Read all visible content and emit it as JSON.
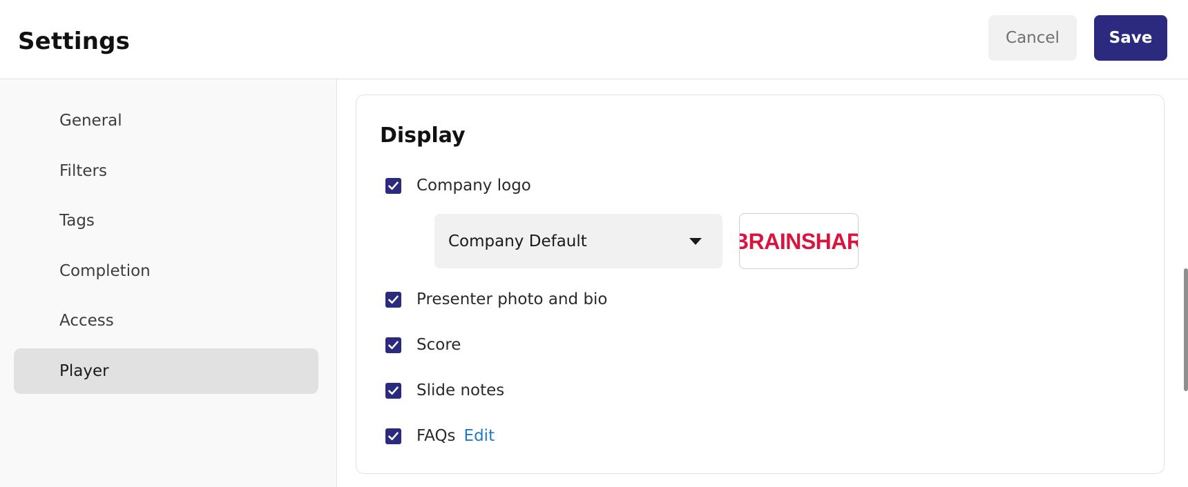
{
  "header": {
    "title": "Settings",
    "cancel_label": "Cancel",
    "save_label": "Save"
  },
  "sidebar": {
    "items": [
      {
        "label": "General",
        "active": false
      },
      {
        "label": "Filters",
        "active": false
      },
      {
        "label": "Tags",
        "active": false
      },
      {
        "label": "Completion",
        "active": false
      },
      {
        "label": "Access",
        "active": false
      },
      {
        "label": "Player",
        "active": true
      }
    ]
  },
  "display": {
    "title": "Display",
    "options": [
      {
        "label": "Company logo",
        "checked": true
      },
      {
        "label": "Presenter photo and bio",
        "checked": true
      },
      {
        "label": "Score",
        "checked": true
      },
      {
        "label": "Slide notes",
        "checked": true
      },
      {
        "label": "FAQs",
        "checked": true,
        "link": "Edit"
      }
    ],
    "logo_select": {
      "value": "Company Default"
    },
    "logo_preview_text": "BRAINSHARK"
  },
  "colors": {
    "accent": "#2b2a7e",
    "link": "#1f79c9",
    "logo": "#d9143f",
    "sidebar_bg": "#f9f9f9",
    "active_item_bg": "#e1e1e1"
  },
  "icons": {
    "checkbox": "check-icon",
    "dropdown": "caret-down-icon"
  }
}
